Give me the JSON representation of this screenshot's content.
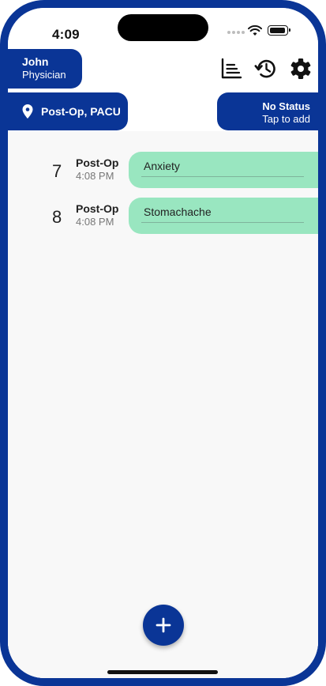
{
  "status_bar": {
    "time": "4:09"
  },
  "header": {
    "user": {
      "name": "John",
      "role": "Physician"
    },
    "location": {
      "label": "Post-Op, PACU",
      "icon": "location-pin-icon"
    },
    "status": {
      "title": "No Status",
      "subtitle": "Tap to add"
    },
    "toolbar": [
      {
        "name": "chart-icon"
      },
      {
        "name": "history-icon"
      },
      {
        "name": "settings-icon"
      }
    ]
  },
  "entries": [
    {
      "number": "7",
      "category": "Post-Op",
      "time": "4:08 PM",
      "note": "Anxiety"
    },
    {
      "number": "8",
      "category": "Post-Op",
      "time": "4:08 PM",
      "note": "Stomachache"
    }
  ],
  "fab": {
    "icon": "plus-icon"
  },
  "colors": {
    "brand": "#0a3596",
    "note_bg": "#99e6c0",
    "background": "#f8f8f8"
  }
}
